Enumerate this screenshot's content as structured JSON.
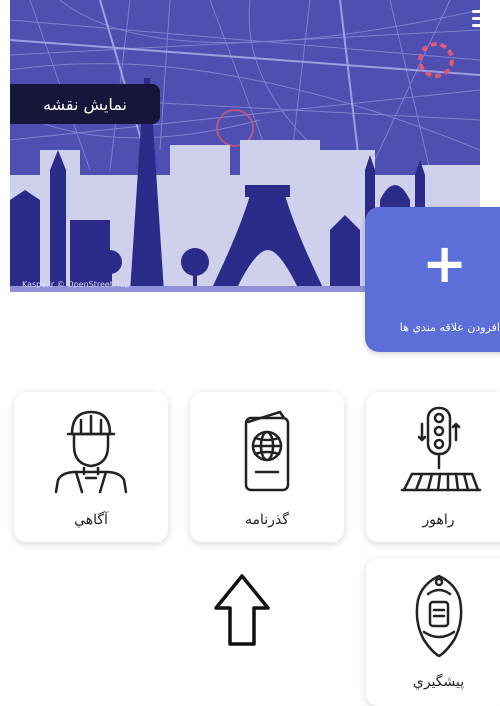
{
  "header": {
    "show_map_label": "نمایش نقشه",
    "credit_text": "Kaspa.ir © OpenStreetMap",
    "menu_icon": "hamburger-menu-icon"
  },
  "add_interest": {
    "plus_symbol": "+",
    "label": "افزودن علاقه مندي ها"
  },
  "tiles": [
    {
      "label": "آگاهي",
      "icon": "police-officer-icon"
    },
    {
      "label": "گذرنامه",
      "icon": "passport-icon"
    },
    {
      "label": "راهور",
      "icon": "traffic-light-icon"
    },
    {
      "label": "پيشگيري",
      "icon": "prevention-emblem-icon"
    }
  ],
  "colors": {
    "banner": "#4e4fb0",
    "skyline_light": "#cfd0ec",
    "skyline_dark": "#2c2b8a",
    "add_card": "#5c6fd8",
    "show_map_bg": "#16163a"
  }
}
